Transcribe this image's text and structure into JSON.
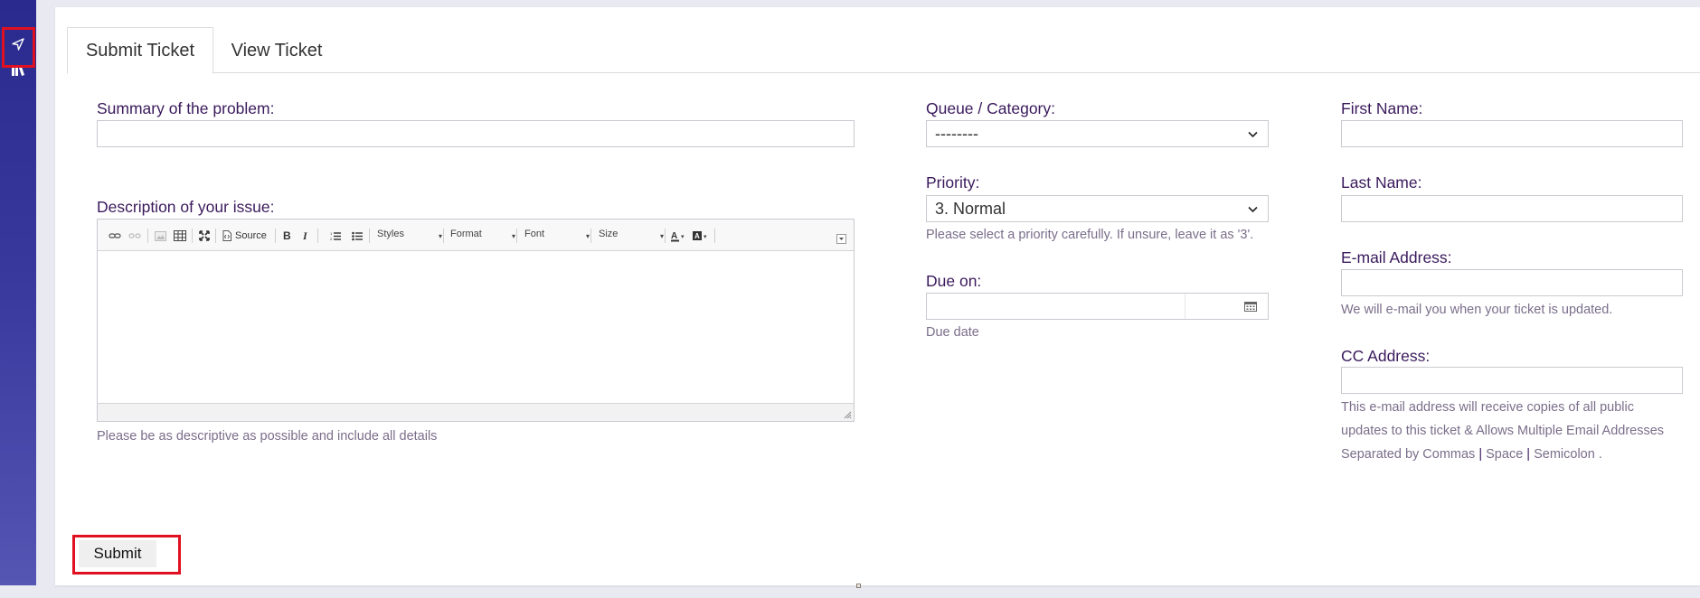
{
  "colors": {
    "sidebar": "#2f2f94",
    "highlight": "#e01020",
    "label": "#3a1a5c",
    "help": "#7a6e8a"
  },
  "sidebar": {
    "items": [
      {
        "icon": "send-icon"
      },
      {
        "icon": "library-icon"
      }
    ]
  },
  "tabs": [
    {
      "label": "Submit Ticket",
      "active": true
    },
    {
      "label": "View Ticket",
      "active": false
    }
  ],
  "form": {
    "summary": {
      "label": "Summary of the problem:",
      "value": ""
    },
    "description": {
      "label": "Description of your issue:",
      "help": "Please be as descriptive as possible and include all details",
      "toolbar": {
        "source": "Source",
        "bold": "B",
        "italic": "I",
        "styles": "Styles",
        "format": "Format",
        "font": "Font",
        "size": "Size"
      }
    },
    "queue": {
      "label": "Queue / Category:",
      "value": "--------"
    },
    "priority": {
      "label": "Priority:",
      "value": "3. Normal",
      "help": "Please select a priority carefully. If unsure, leave it as '3'."
    },
    "due": {
      "label": "Due on:",
      "help": "Due date"
    },
    "first_name": {
      "label": "First Name:"
    },
    "last_name": {
      "label": "Last Name:"
    },
    "email": {
      "label": "E-mail Address:",
      "help": "We will e-mail you when your ticket is updated."
    },
    "cc": {
      "label": "CC Address:",
      "help_line1": "This e-mail address will receive copies of all public",
      "help_line2": "updates to this ticket & Allows Multiple Email Addresses",
      "help_line3_a": "Separated by Commas",
      "help_sep1": "|",
      "help_line3_b": "Space",
      "help_sep2": "|",
      "help_line3_c": "Semicolon ."
    },
    "submit_label": "Submit"
  }
}
